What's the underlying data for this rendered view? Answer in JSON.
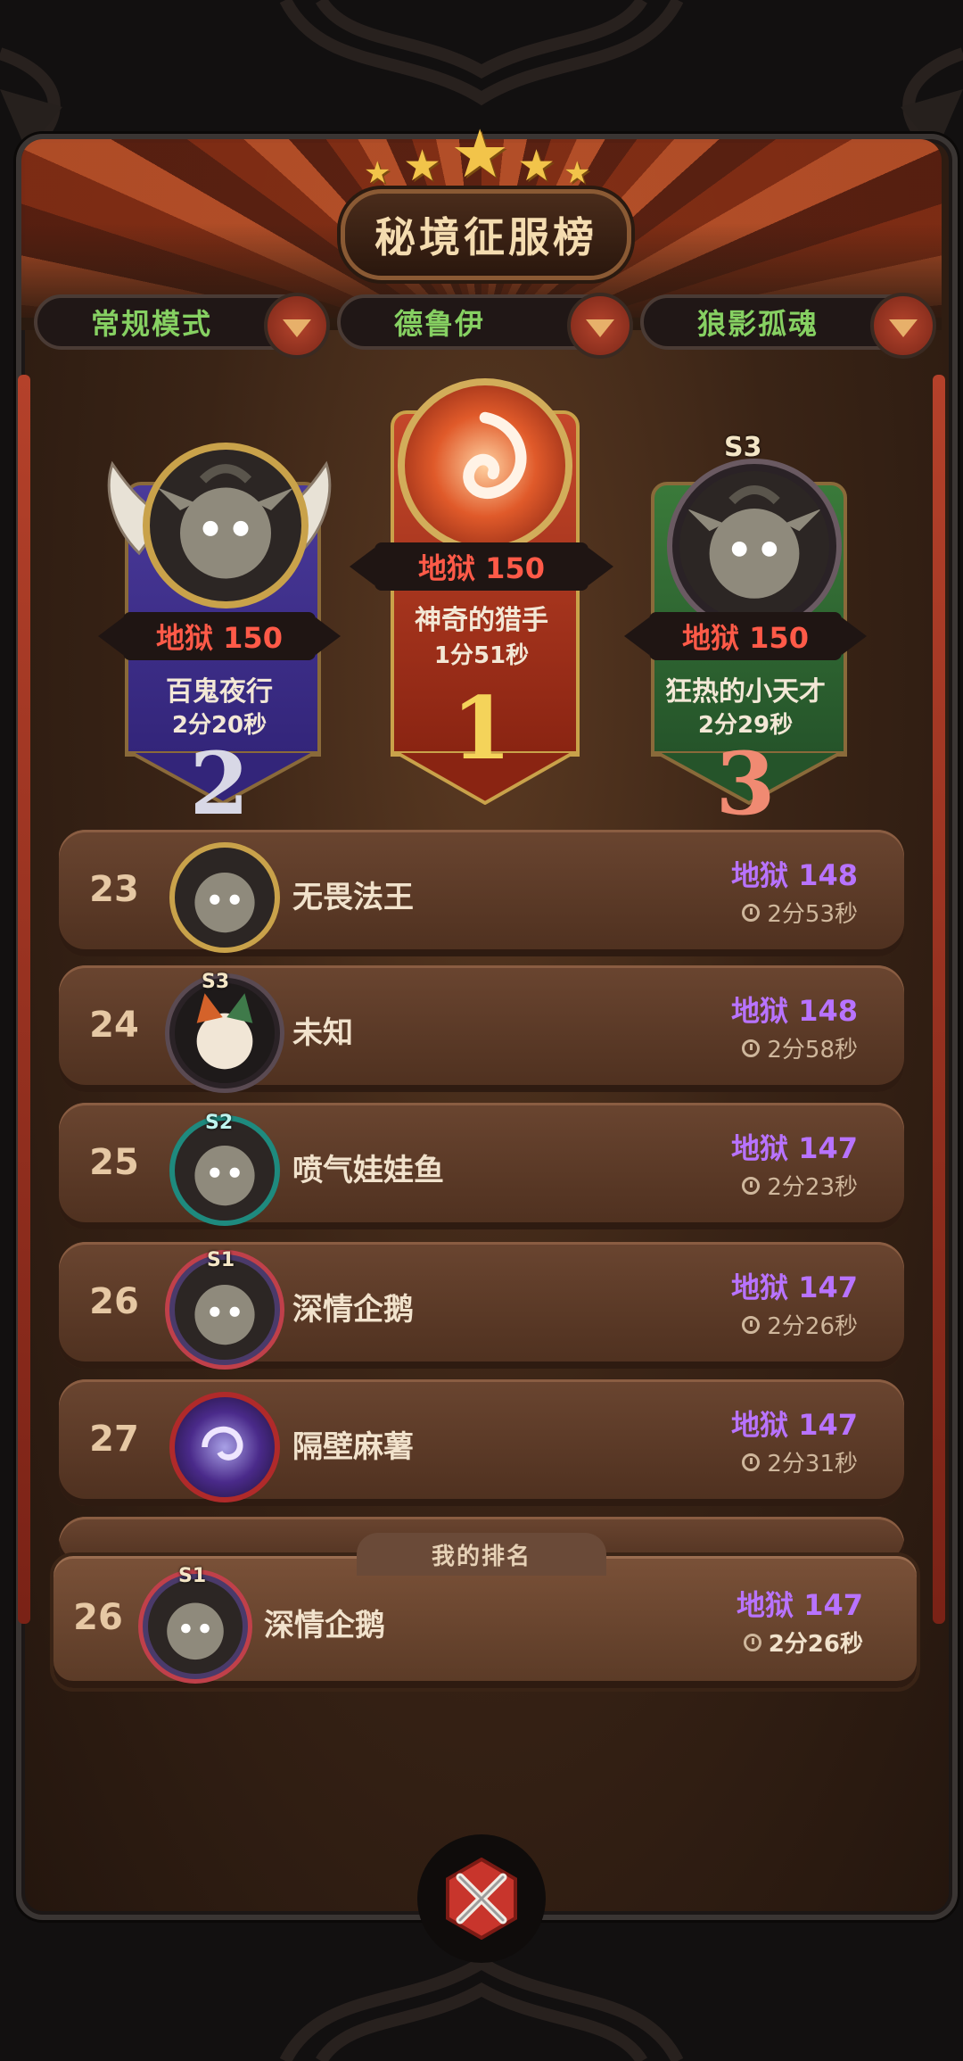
{
  "header": {
    "title": "秘境征服榜"
  },
  "filters": [
    {
      "label": "常规模式"
    },
    {
      "label": "德鲁伊"
    },
    {
      "label": "狼影孤魂"
    }
  ],
  "podium": {
    "first": {
      "difficulty": "地狱 150",
      "name": "神奇的猎手",
      "time": "1分51秒",
      "rank": "1"
    },
    "second": {
      "difficulty": "地狱 150",
      "name": "百鬼夜行",
      "time": "2分20秒",
      "rank": "2"
    },
    "third": {
      "difficulty": "地狱 150",
      "name": "狂热的小天才",
      "time": "2分29秒",
      "rank": "3",
      "season": "S3"
    }
  },
  "list": [
    {
      "rank": "23",
      "name": "无畏法王",
      "score": "地狱 148",
      "time": "2分53秒"
    },
    {
      "rank": "24",
      "name": "未知",
      "score": "地狱 148",
      "time": "2分58秒",
      "season": "S3"
    },
    {
      "rank": "25",
      "name": "喷气娃娃鱼",
      "score": "地狱 147",
      "time": "2分23秒",
      "season": "S2"
    },
    {
      "rank": "26",
      "name": "深情企鹅",
      "score": "地狱 147",
      "time": "2分26秒",
      "season": "S1"
    },
    {
      "rank": "27",
      "name": "隔壁麻薯",
      "score": "地狱 147",
      "time": "2分31秒"
    }
  ],
  "my_rank": {
    "label": "我的排名",
    "rank": "26",
    "name": "深情企鹅",
    "score": "地狱 147",
    "time": "2分26秒",
    "season": "S1"
  },
  "icons": {
    "close": "close-x-icon",
    "dropdown": "chevron-down-icon",
    "clock": "clock-icon"
  },
  "colors": {
    "gold": "#f2c44a",
    "hell_red": "#ff5a48",
    "score_purple": "#b873ff",
    "filter_green": "#86d062"
  }
}
